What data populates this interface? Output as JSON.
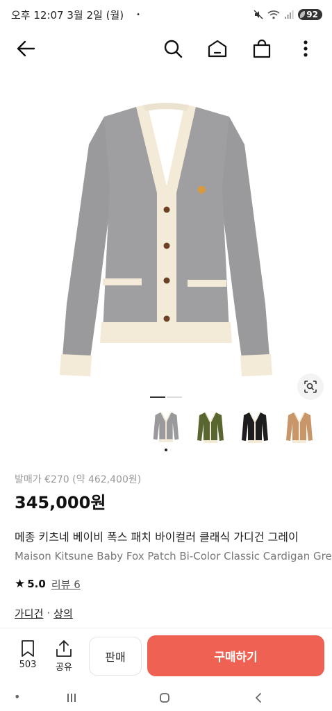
{
  "status": {
    "time": "오후 12:07  3월 2일 (월)",
    "dot": "•",
    "battery": "92",
    "icons": [
      "mute-icon",
      "wifi-icon",
      "signal-icon",
      "battery-icon"
    ]
  },
  "header": {
    "icons": [
      "back-arrow-icon",
      "search-icon",
      "home-icon",
      "shopping-bag-icon",
      "more-vertical-icon"
    ]
  },
  "product": {
    "release_price": "발매가 €270 (약 462,400원)",
    "price": "345,000원",
    "name_ko": "메종 키츠네 베이비 폭스 패치 바이컬러 클래식 가디건 그레이",
    "name_en": "Maison Kitsune Baby Fox Patch Bi-Color Classic Cardigan Grey",
    "rating_star": "★",
    "rating": "5.0",
    "reviews": "리뷰 6",
    "category_1": "가디건",
    "category_sep": "·",
    "category_2": "상의"
  },
  "colors": {
    "grey": "#9a9a9c",
    "olive": "#5a6630",
    "black": "#1e1e1e",
    "camel": "#c9966a",
    "trim": "#f3ead8",
    "accent": "#ef6253"
  },
  "bottom": {
    "save_count": "503",
    "share_label": "공유",
    "sell_label": "판매",
    "buy_label": "구매하기"
  }
}
